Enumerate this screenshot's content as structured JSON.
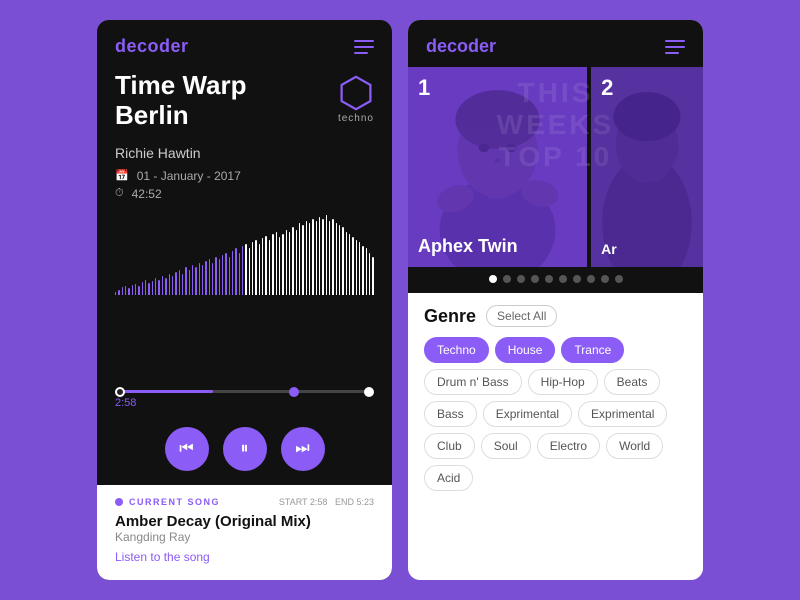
{
  "app": {
    "name": "decoder"
  },
  "left": {
    "logo": "decoder",
    "track": {
      "title": "Time Warp\nBerlin",
      "title_line1": "Time Warp",
      "title_line2": "Berlin",
      "genre_badge": "techno",
      "artist": "Richie Hawtin",
      "date": "01 - January - 2017",
      "duration": "42:52",
      "current_time": "2:58"
    },
    "controls": {
      "rewind": "⏮",
      "pause": "⏸",
      "forward": "⏭"
    },
    "current_song": {
      "label": "CURRENT SONG",
      "start_label": "START",
      "start": "2:58",
      "end_label": "END",
      "end": "5:23",
      "title": "Amber Decay (Original Mix)",
      "artist": "Kangding Ray",
      "link": "Listen to the song"
    }
  },
  "right": {
    "logo": "decoder",
    "top10": {
      "line1": "THIS WEEKS",
      "line2": "TOP 10"
    },
    "artists": [
      {
        "rank": "1",
        "name": "Aphex Twin"
      },
      {
        "rank": "2",
        "name": "Ar"
      }
    ],
    "genre": {
      "title": "Genre",
      "select_all": "Select All",
      "tags": [
        {
          "label": "Techno",
          "active": true
        },
        {
          "label": "House",
          "active": true
        },
        {
          "label": "Trance",
          "active": true
        },
        {
          "label": "Drum n' Bass",
          "active": false
        },
        {
          "label": "Hip-Hop",
          "active": false
        },
        {
          "label": "Beats",
          "active": false
        },
        {
          "label": "Bass",
          "active": false
        },
        {
          "label": "Exprimental",
          "active": false
        },
        {
          "label": "Exprimental",
          "active": false
        },
        {
          "label": "Club",
          "active": false
        },
        {
          "label": "Soul",
          "active": false
        },
        {
          "label": "Electro",
          "active": false
        },
        {
          "label": "World",
          "active": false
        },
        {
          "label": "Acid",
          "active": false
        }
      ]
    }
  },
  "colors": {
    "accent": "#8b5cf6",
    "bg": "#7b4fd4",
    "dark": "#111111",
    "light": "#f5f5f5"
  },
  "waveform_bars": [
    3,
    5,
    7,
    8,
    6,
    9,
    10,
    8,
    12,
    14,
    11,
    13,
    16,
    14,
    18,
    16,
    20,
    18,
    22,
    24,
    20,
    26,
    24,
    28,
    26,
    30,
    28,
    32,
    34,
    30,
    36,
    34,
    38,
    40,
    36,
    42,
    44,
    40,
    46,
    48,
    44,
    50,
    52,
    48,
    54,
    56,
    52,
    58,
    60,
    55,
    58,
    62,
    60,
    64,
    62,
    68,
    66,
    70,
    68,
    72,
    70,
    74,
    72,
    76,
    70,
    72,
    68,
    66,
    64,
    60,
    58,
    55,
    52,
    50,
    46,
    44,
    40,
    36
  ],
  "carousel_dots": [
    true,
    false,
    false,
    false,
    false,
    false,
    false,
    false,
    false,
    false
  ]
}
